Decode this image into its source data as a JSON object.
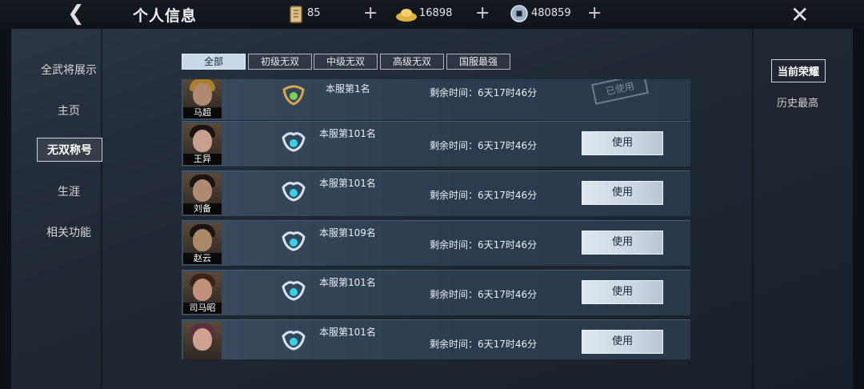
{
  "header": {
    "title": "个人信息",
    "resources": [
      {
        "icon": "token-icon",
        "value": "85"
      },
      {
        "icon": "gold-ingot-icon",
        "value": "16898"
      },
      {
        "icon": "coin-icon",
        "value": "480859"
      }
    ]
  },
  "left_nav": {
    "items": [
      {
        "label": "全武将展示",
        "active": false
      },
      {
        "label": "主页",
        "active": false
      },
      {
        "label": "无双称号",
        "active": true
      },
      {
        "label": "生涯",
        "active": false
      },
      {
        "label": "相关功能",
        "active": false
      }
    ]
  },
  "right_nav": {
    "items": [
      {
        "label": "当前荣耀",
        "active": true
      },
      {
        "label": "历史最高",
        "active": false
      }
    ]
  },
  "filters": [
    {
      "label": "全部",
      "active": true
    },
    {
      "label": "初级无双",
      "active": false
    },
    {
      "label": "中级无双",
      "active": false
    },
    {
      "label": "高级无双",
      "active": false
    },
    {
      "label": "国服最强",
      "active": false
    }
  ],
  "rows": [
    {
      "name": "马超",
      "rank": "本服第1名",
      "time": "剩余时间：6天17时46分",
      "button": "",
      "stamp": "已使用",
      "emblem": "gold"
    },
    {
      "name": "王异",
      "rank": "本服第101名",
      "time": "剩余时间：6天17时46分",
      "button": "使用",
      "stamp": "",
      "emblem": "silver"
    },
    {
      "name": "刘备",
      "rank": "本服第101名",
      "time": "剩余时间：6天17时46分",
      "button": "使用",
      "stamp": "",
      "emblem": "silver"
    },
    {
      "name": "赵云",
      "rank": "本服第109名",
      "time": "剩余时间：6天17时46分",
      "button": "使用",
      "stamp": "",
      "emblem": "silver"
    },
    {
      "name": "司马昭",
      "rank": "本服第101名",
      "time": "剩余时间：6天17时46分",
      "button": "使用",
      "stamp": "",
      "emblem": "silver"
    },
    {
      "name": "",
      "rank": "本服第101名",
      "time": "剩余时间：6天17时46分",
      "button": "使用",
      "stamp": "",
      "emblem": "silver"
    }
  ],
  "colors": {
    "gold_emblem": "#d9a84a",
    "silver_emblem": "#cfe3f0",
    "accent_cyan": "#36d0e8"
  }
}
